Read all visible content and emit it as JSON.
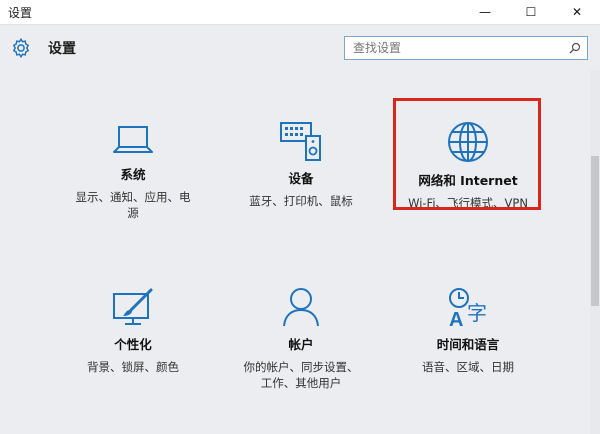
{
  "window": {
    "title": "设置"
  },
  "controls": {
    "minimize": "—",
    "maximize": "☐",
    "close": "✕"
  },
  "header": {
    "label": "设置",
    "search_placeholder": "查找设置"
  },
  "tiles": [
    {
      "name": "系统",
      "desc_lines": [
        "显示、通知、应用、电",
        "源"
      ],
      "icon": "laptop-icon"
    },
    {
      "name": "设备",
      "desc_lines": [
        "蓝牙、打印机、鼠标"
      ],
      "icon": "devices-icon"
    },
    {
      "name": "网络和 Internet",
      "desc_lines": [
        "Wi-Fi、飞行模式、VPN"
      ],
      "icon": "globe-icon"
    },
    {
      "name": "个性化",
      "desc_lines": [
        "背景、锁屏、颜色"
      ],
      "icon": "paint-icon"
    },
    {
      "name": "帐户",
      "desc_lines": [
        "你的帐户、同步设置、",
        "工作、其他用户"
      ],
      "icon": "person-icon"
    },
    {
      "name": "时间和语言",
      "desc_lines": [
        "语音、区域、日期"
      ],
      "icon": "time-language-icon"
    }
  ],
  "colors": {
    "accent": "#1e73be",
    "highlight": "#d9261c"
  }
}
